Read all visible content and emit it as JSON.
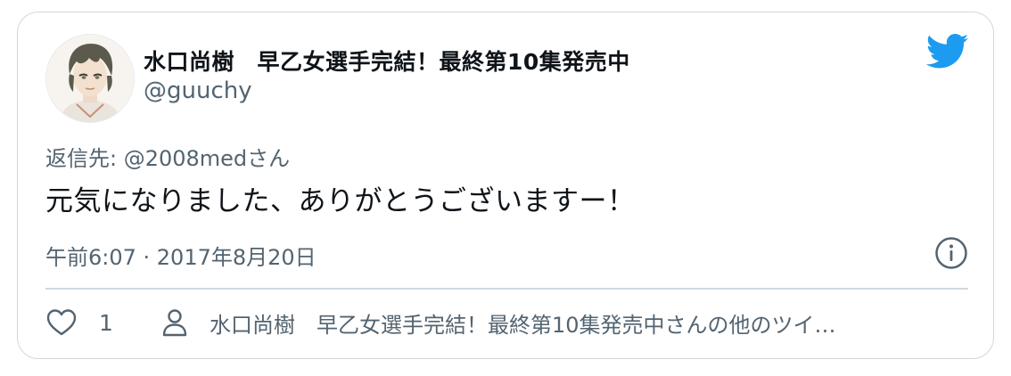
{
  "author": {
    "display_name": "水口尚樹　早乙女選手完結！最終第10集発売中",
    "handle": "@guuchy",
    "avatar": "anime-portrait-avatar"
  },
  "brand": {
    "icon": "twitter-bird-icon",
    "color": "#1d9bf0"
  },
  "reply_to": "返信先: @2008medさん",
  "tweet": {
    "text": "元気になりました、ありがとうございますー！",
    "timestamp": "午前6:07 · 2017年8月20日"
  },
  "footer": {
    "like_count": "1",
    "more_tweets_label": "水口尚樹　早乙女選手完結！最終第10集発売中さんの他のツイ…"
  },
  "icons": {
    "info": "info-icon",
    "like": "heart-icon",
    "profile": "person-icon"
  }
}
